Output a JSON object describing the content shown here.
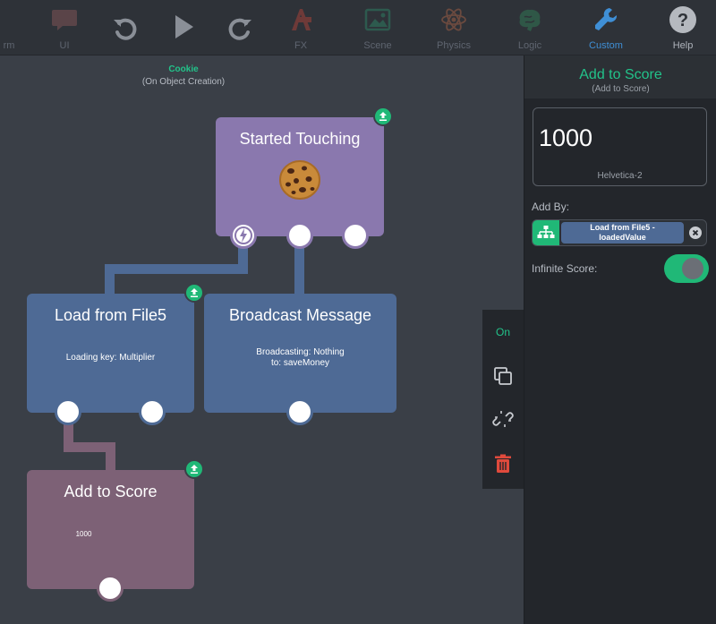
{
  "toolbar": {
    "items": [
      {
        "label": "rm",
        "icon": "form-icon"
      },
      {
        "label": "UI",
        "icon": "speech-bubble-icon"
      },
      {
        "label": "",
        "icon": "undo-icon"
      },
      {
        "label": "",
        "icon": "play-icon"
      },
      {
        "label": "",
        "icon": "redo-icon"
      },
      {
        "label": "FX",
        "icon": "fx-icon"
      },
      {
        "label": "Scene",
        "icon": "scene-image-icon"
      },
      {
        "label": "Physics",
        "icon": "atom-icon"
      },
      {
        "label": "Logic",
        "icon": "brain-icon"
      },
      {
        "label": "Custom",
        "icon": "wrench-icon"
      },
      {
        "label": "Help",
        "icon": "help-icon"
      }
    ]
  },
  "canvas": {
    "object_name": "Cookie",
    "trigger": "(On Object Creation)",
    "blocks": {
      "started_touching": {
        "title": "Started Touching",
        "image": "cookie-icon",
        "color": "#8a78ae"
      },
      "load_file": {
        "title": "Load from File5",
        "body": "Loading key: Multiplier",
        "color": "#4e6a95"
      },
      "broadcast": {
        "title": "Broadcast Message",
        "body_line1": "Broadcasting: Nothing",
        "body_line2": "to: saveMoney",
        "color": "#4e6a95"
      },
      "add_score": {
        "title": "Add to Score",
        "body": "1000",
        "color": "#7d6176"
      }
    }
  },
  "side_strip": {
    "status": "On",
    "icons": [
      "duplicate-icon",
      "unlink-icon",
      "trash-icon"
    ]
  },
  "panel": {
    "title": "Add to Score",
    "subtitle": "(Add to Score)",
    "score_value": "1000",
    "score_font": "Helvetica-2",
    "add_by_label": "Add By:",
    "add_by_value_line1": "Load from File5 -",
    "add_by_value_line2": "loadedValue",
    "infinite_label": "Infinite Score:",
    "infinite_on": true
  },
  "colors": {
    "accent_green": "#22c38a",
    "active_blue": "#3f8fd6",
    "background": "#3a3f47"
  }
}
